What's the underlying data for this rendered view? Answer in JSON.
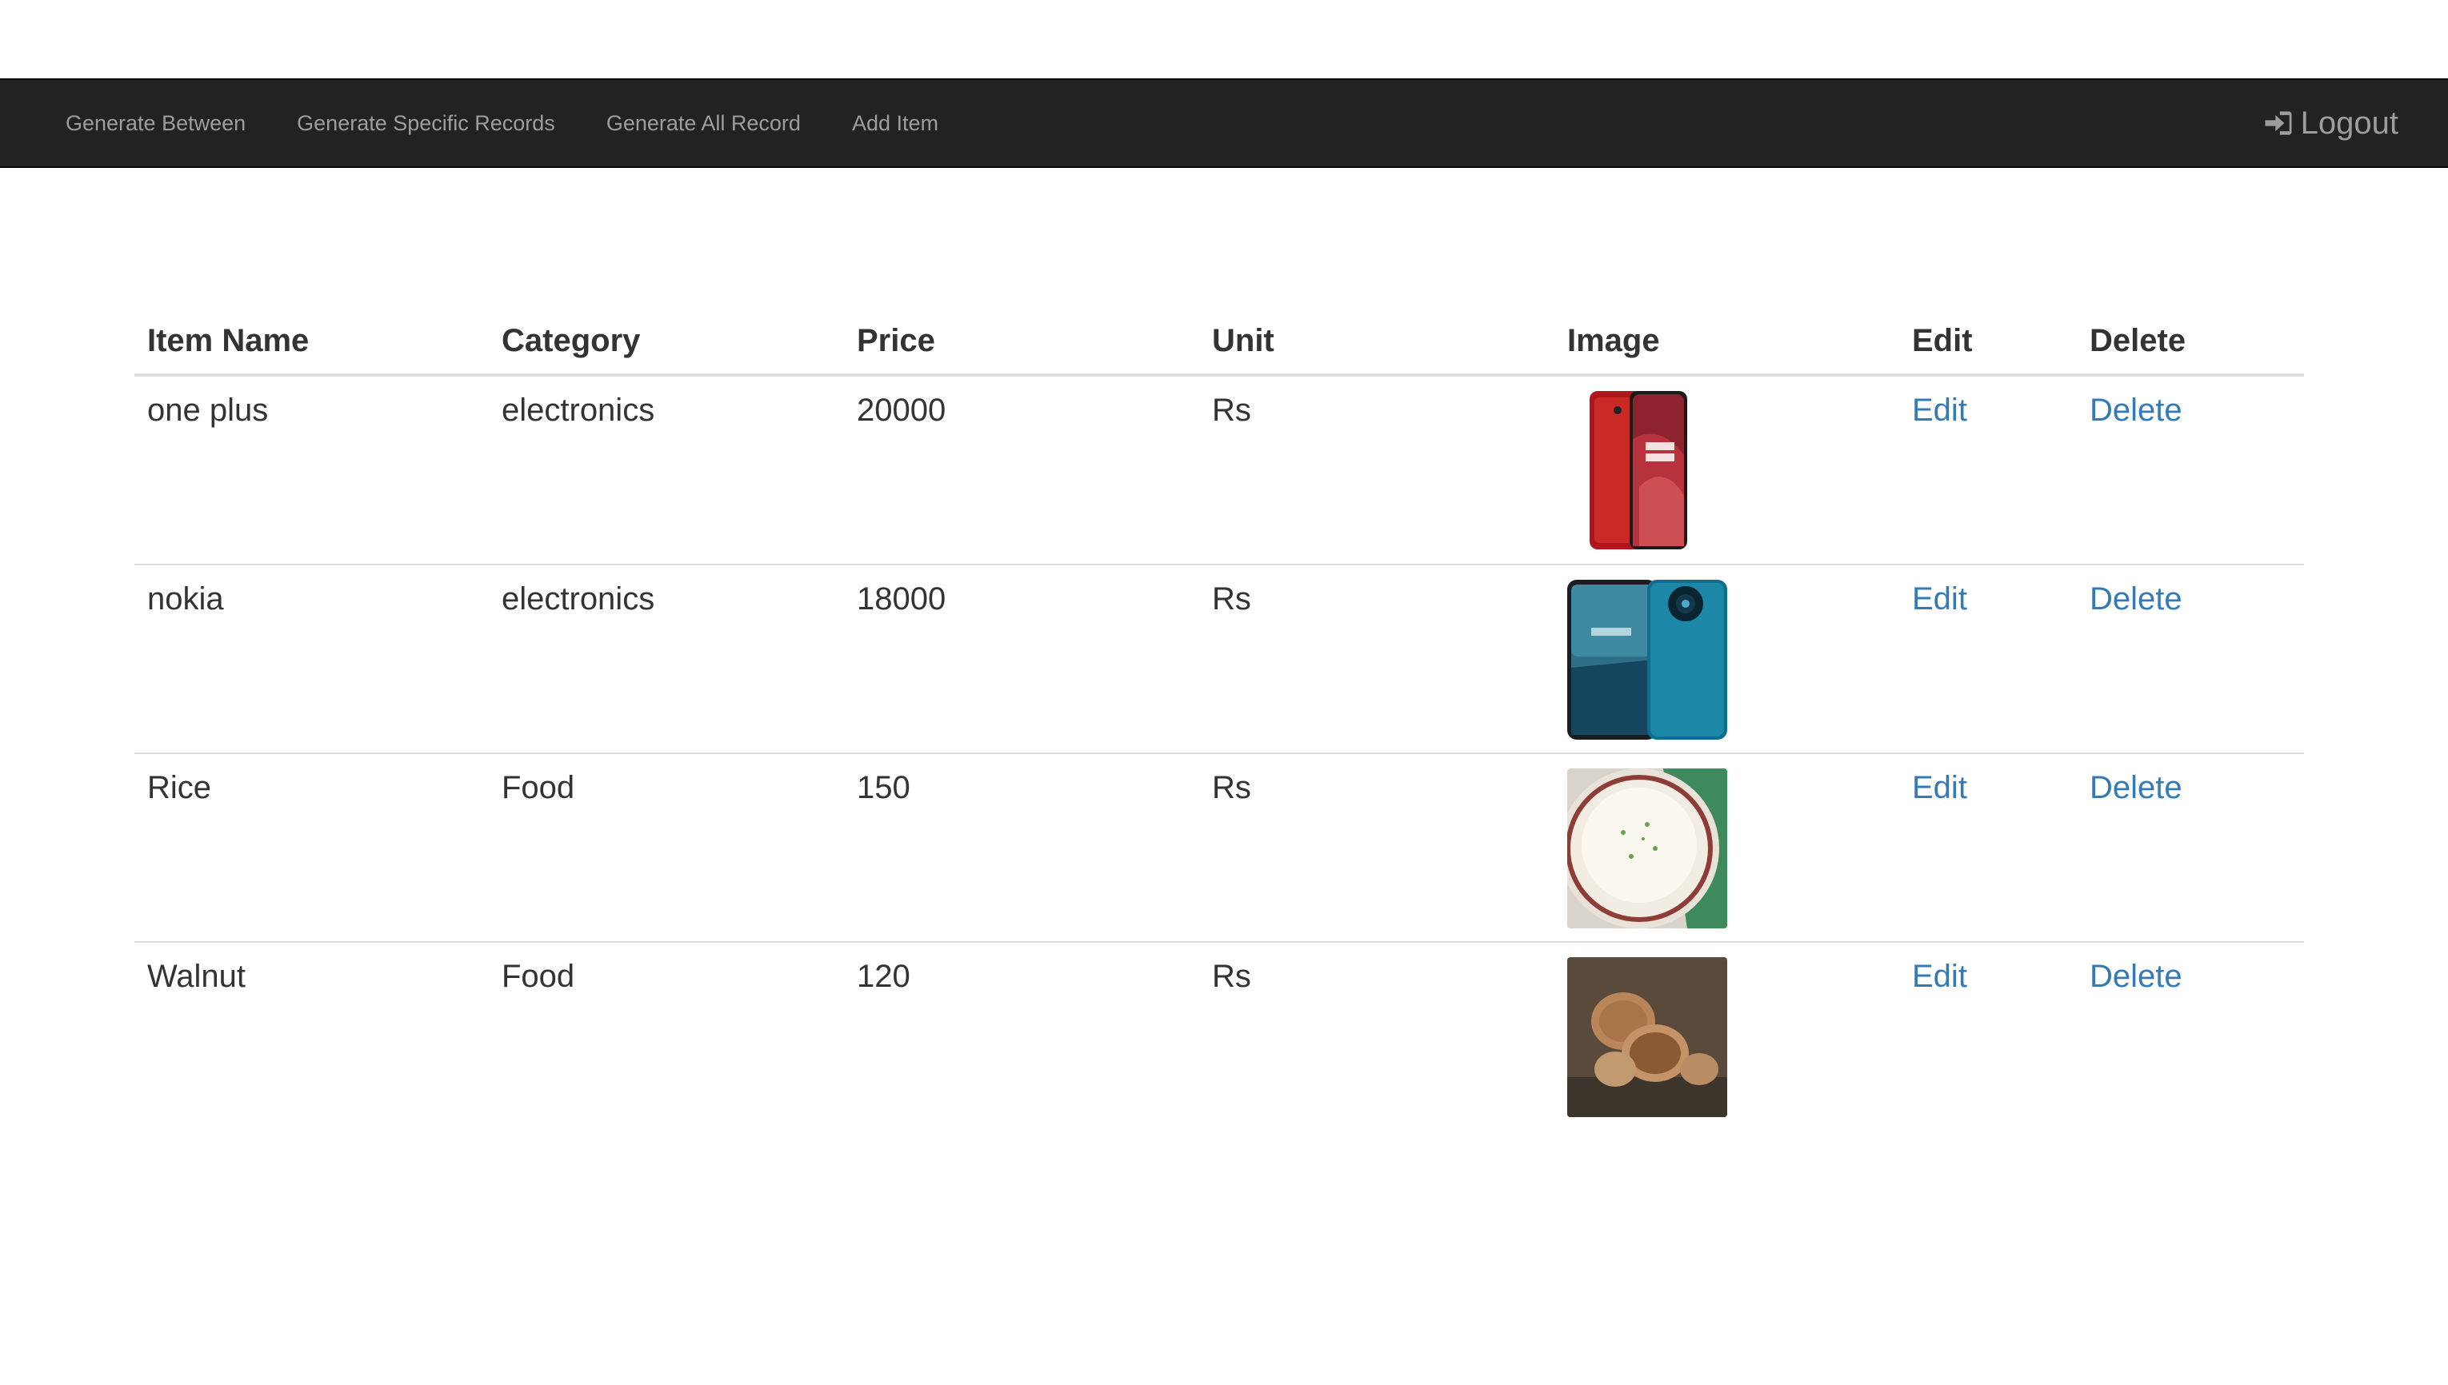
{
  "nav": {
    "items": [
      {
        "label": "Generate Between"
      },
      {
        "label": "Generate Specific Records"
      },
      {
        "label": "Generate All Record"
      },
      {
        "label": "Add Item"
      }
    ],
    "logout_label": "Logout"
  },
  "table": {
    "headers": [
      "Item Name",
      "Category",
      "Price",
      "Unit",
      "Image",
      "Edit",
      "Delete"
    ],
    "rows": [
      {
        "name": "one plus",
        "category": "electronics",
        "price": "20000",
        "unit": "Rs",
        "image_icon": "red-smartphone-image",
        "edit": "Edit",
        "delete": "Delete"
      },
      {
        "name": "nokia",
        "category": "electronics",
        "price": "18000",
        "unit": "Rs",
        "image_icon": "blue-smartphone-image",
        "edit": "Edit",
        "delete": "Delete"
      },
      {
        "name": "Rice",
        "category": "Food",
        "price": "150",
        "unit": "Rs",
        "image_icon": "rice-bowl-image",
        "edit": "Edit",
        "delete": "Delete"
      },
      {
        "name": "Walnut",
        "category": "Food",
        "price": "120",
        "unit": "Rs",
        "image_icon": "walnuts-image",
        "edit": "Edit",
        "delete": "Delete"
      }
    ]
  },
  "colors": {
    "navbar": "#222222",
    "nav_text": "#9d9d9d",
    "link": "#337ab7",
    "text": "#333333",
    "divider": "#dddddd"
  }
}
